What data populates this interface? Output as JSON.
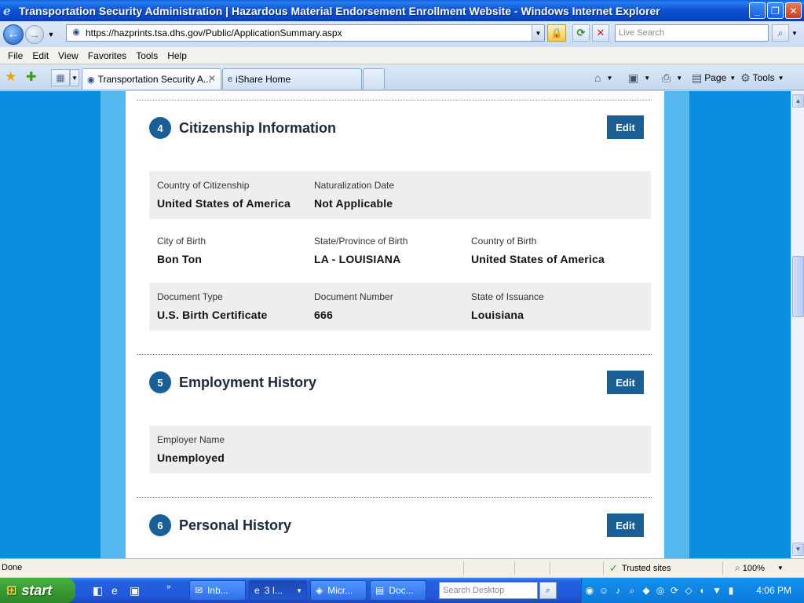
{
  "window": {
    "title": "Transportation Security Administration | Hazardous Material Endorsement Enrollment Website - Windows Internet Explorer",
    "minimize": "_",
    "maximize": "❐",
    "close": "✕"
  },
  "address": {
    "url": "https://hazprints.tsa.dhs.gov/Public/ApplicationSummary.aspx",
    "search_placeholder": "Live Search"
  },
  "menu": [
    "File",
    "Edit",
    "View",
    "Favorites",
    "Tools",
    "Help"
  ],
  "tabs": [
    {
      "label": "Transportation Security A...",
      "active": true
    },
    {
      "label": "iShare Home",
      "active": false
    }
  ],
  "commandbar": {
    "page_label": "Page",
    "tools_label": "Tools"
  },
  "sections": [
    {
      "number": "4",
      "title": "Citizenship Information",
      "edit_label": "Edit",
      "rows": [
        {
          "fields": [
            {
              "label": "Country of Citizenship",
              "value": "United States of America"
            },
            {
              "label": "Naturalization Date",
              "value": "Not Applicable"
            }
          ]
        },
        {
          "fields": [
            {
              "label": "City of Birth",
              "value": "Bon Ton"
            },
            {
              "label": "State/Province of Birth",
              "value": "LA - LOUISIANA"
            },
            {
              "label": "Country of Birth",
              "value": "United States of America"
            }
          ]
        },
        {
          "fields": [
            {
              "label": "Document Type",
              "value": "U.S. Birth Certificate"
            },
            {
              "label": "Document Number",
              "value": "666"
            },
            {
              "label": "State of Issuance",
              "value": "Louisiana"
            }
          ]
        }
      ]
    },
    {
      "number": "5",
      "title": "Employment History",
      "edit_label": "Edit",
      "rows": [
        {
          "fields": [
            {
              "label": "Employer Name",
              "value": "Unemployed"
            }
          ]
        }
      ]
    },
    {
      "number": "6",
      "title": "Personal History",
      "edit_label": "Edit"
    }
  ],
  "status": {
    "text": "Done",
    "zone": "Trusted sites",
    "zoom": "100%"
  },
  "taskbar": {
    "start_label": "start",
    "buttons": [
      {
        "label": "Inb..."
      },
      {
        "label": "3 I..."
      },
      {
        "label": "Micr..."
      },
      {
        "label": "Doc..."
      }
    ],
    "search_placeholder": "Search Desktop",
    "clock": "4:06 PM"
  }
}
